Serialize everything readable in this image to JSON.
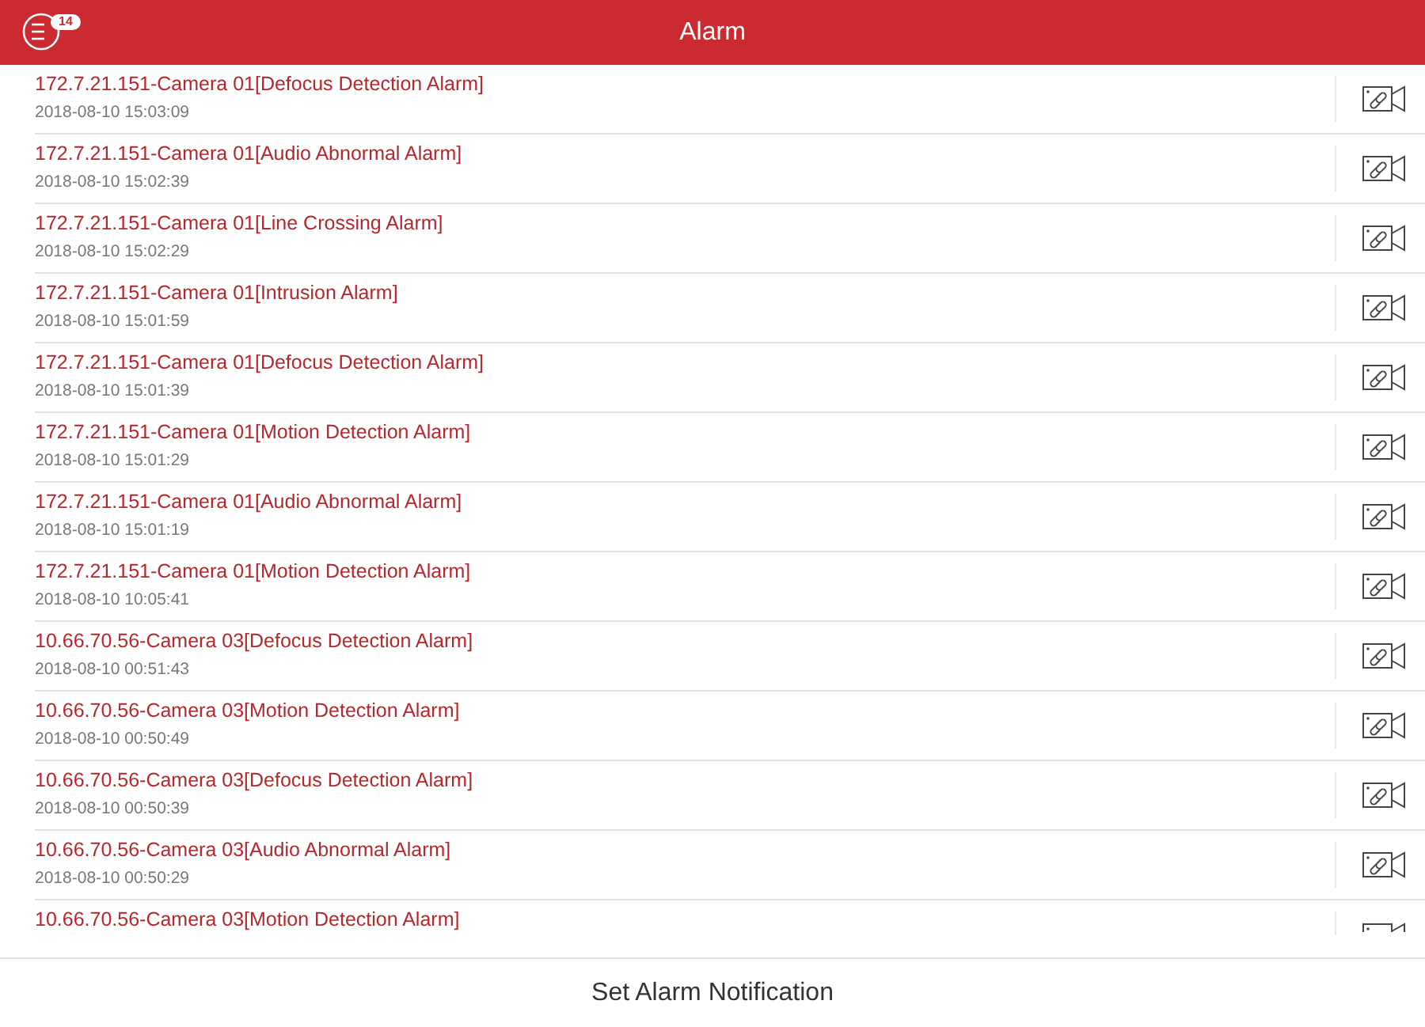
{
  "header": {
    "title": "Alarm",
    "menu_badge": "14"
  },
  "alarms": [
    {
      "title": "172.7.21.151-Camera 01[Defocus Detection Alarm]",
      "time": "2018-08-10 15:03:09"
    },
    {
      "title": "172.7.21.151-Camera 01[Audio Abnormal Alarm]",
      "time": "2018-08-10 15:02:39"
    },
    {
      "title": "172.7.21.151-Camera 01[Line Crossing Alarm]",
      "time": "2018-08-10 15:02:29"
    },
    {
      "title": "172.7.21.151-Camera 01[Intrusion Alarm]",
      "time": "2018-08-10 15:01:59"
    },
    {
      "title": "172.7.21.151-Camera 01[Defocus Detection Alarm]",
      "time": "2018-08-10 15:01:39"
    },
    {
      "title": "172.7.21.151-Camera 01[Motion Detection Alarm]",
      "time": "2018-08-10 15:01:29"
    },
    {
      "title": "172.7.21.151-Camera 01[Audio Abnormal Alarm]",
      "time": "2018-08-10 15:01:19"
    },
    {
      "title": "172.7.21.151-Camera 01[Motion Detection Alarm]",
      "time": "2018-08-10 10:05:41"
    },
    {
      "title": "10.66.70.56-Camera 03[Defocus Detection Alarm]",
      "time": "2018-08-10 00:51:43"
    },
    {
      "title": "10.66.70.56-Camera 03[Motion Detection Alarm]",
      "time": "2018-08-10 00:50:49"
    },
    {
      "title": "10.66.70.56-Camera 03[Defocus Detection Alarm]",
      "time": "2018-08-10 00:50:39"
    },
    {
      "title": "10.66.70.56-Camera 03[Audio Abnormal Alarm]",
      "time": "2018-08-10 00:50:29"
    },
    {
      "title": "10.66.70.56-Camera 03[Motion Detection Alarm]"
    }
  ],
  "footer": {
    "button": "Set Alarm Notification"
  }
}
